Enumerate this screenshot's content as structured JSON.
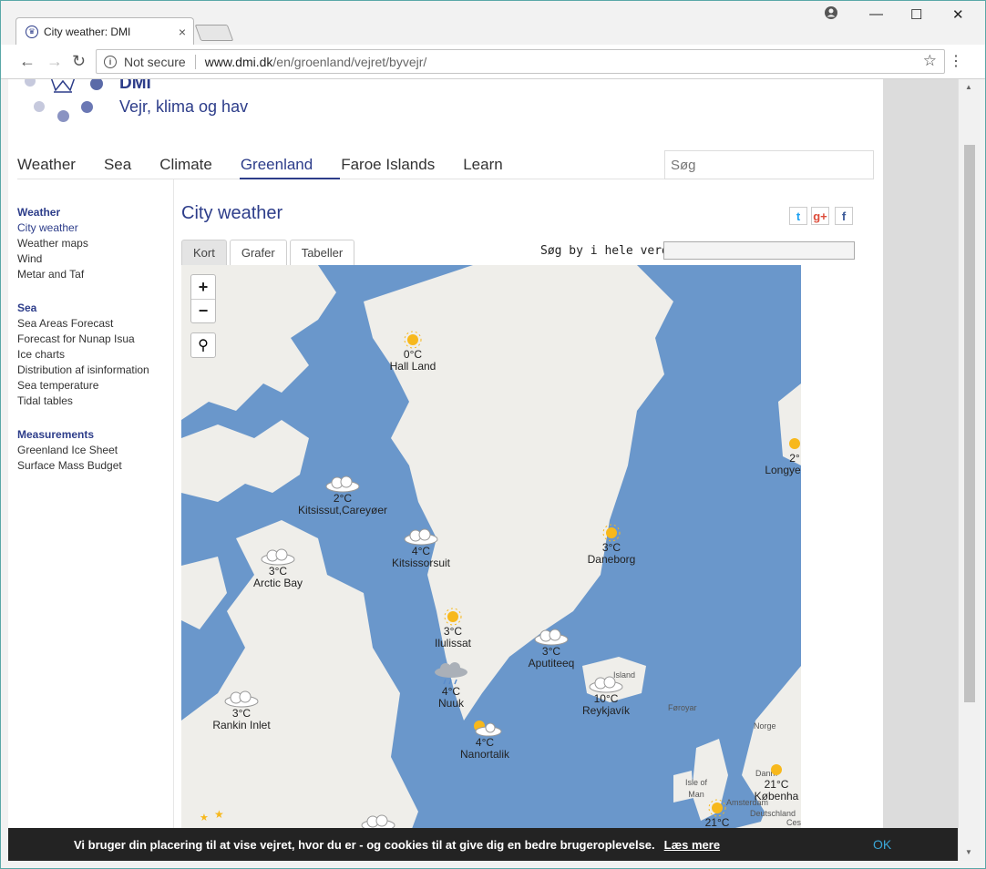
{
  "browser": {
    "tab_title": "City weather: DMI",
    "tab_close": "×",
    "not_secure": "Not secure",
    "url_host": "www.dmi.dk",
    "url_path": "/en/groenland/vejret/byvejr/",
    "win_min": "—",
    "win_max": "☐",
    "win_close": "✕",
    "back": "←",
    "forward": "→",
    "reload": "↻",
    "star": "☆",
    "menu": "⋮",
    "info": "i"
  },
  "site": {
    "brand": "DMI",
    "tagline": "Vejr, klima og hav",
    "search_placeholder": "Søg"
  },
  "topnav": [
    "Weather",
    "Sea",
    "Climate",
    "Greenland",
    "Faroe Islands",
    "Learn"
  ],
  "sidebar": {
    "weather_head": "Weather",
    "weather_items": [
      "City weather",
      "Weather maps",
      "Wind",
      "Metar and Taf"
    ],
    "sea_head": "Sea",
    "sea_items": [
      "Sea Areas Forecast",
      "Forecast for Nunap Isua",
      "Ice charts",
      "Distribution af isinformation",
      "Sea temperature",
      "Tidal tables"
    ],
    "meas_head": "Measurements",
    "meas_items": [
      "Greenland Ice Sheet",
      "Surface Mass Budget"
    ]
  },
  "content": {
    "title": "City weather",
    "tabs": [
      "Kort",
      "Grafer",
      "Tabeller"
    ],
    "city_search_label": "Søg by i hele verden:",
    "zoom_in": "+",
    "zoom_out": "−"
  },
  "social": {
    "twitter": "t",
    "google": "g+",
    "facebook": "f"
  },
  "map": {
    "region_labels": [
      "Island",
      "Føroyar",
      "Norge",
      "Isle of Man",
      "Amsterdam",
      "Danm",
      "Deutschland",
      "Ces"
    ],
    "cities": [
      {
        "name": "Hall Land",
        "temp": "0°C",
        "icon": "sun"
      },
      {
        "name": "Kitsissut,Careyøer",
        "temp": "2°C",
        "icon": "cloud"
      },
      {
        "name": "Kitsissorsuit",
        "temp": "4°C",
        "icon": "cloud"
      },
      {
        "name": "Arctic Bay",
        "temp": "3°C",
        "icon": "cloud"
      },
      {
        "name": "Daneborg",
        "temp": "3°C",
        "icon": "sun"
      },
      {
        "name": "Ilulissat",
        "temp": "3°C",
        "icon": "sun"
      },
      {
        "name": "Aputiteeq",
        "temp": "3°C",
        "icon": "cloud"
      },
      {
        "name": "Reykjavík",
        "temp": "10°C",
        "icon": "cloud"
      },
      {
        "name": "Nuuk",
        "temp": "4°C",
        "icon": "rain"
      },
      {
        "name": "Nanortalik",
        "temp": "4°C",
        "icon": "sun-cloud"
      },
      {
        "name": "Rankin Inlet",
        "temp": "3°C",
        "icon": "cloud"
      },
      {
        "name": "Longye",
        "temp": "2°",
        "icon": "sun"
      },
      {
        "name": "Københa",
        "temp": "21°C",
        "icon": "sun"
      },
      {
        "name": "",
        "temp": "21°C",
        "icon": "sun"
      }
    ]
  },
  "cookie": {
    "message": "Vi bruger din placering til at vise vejret, hvor du er - og cookies til at give dig en bedre brugeroplevelse.",
    "more": "Læs mere",
    "ok": "OK"
  },
  "colors": {
    "brand": "#2d3d8a",
    "sea": "#6a97cb",
    "land": "#efeeea"
  }
}
